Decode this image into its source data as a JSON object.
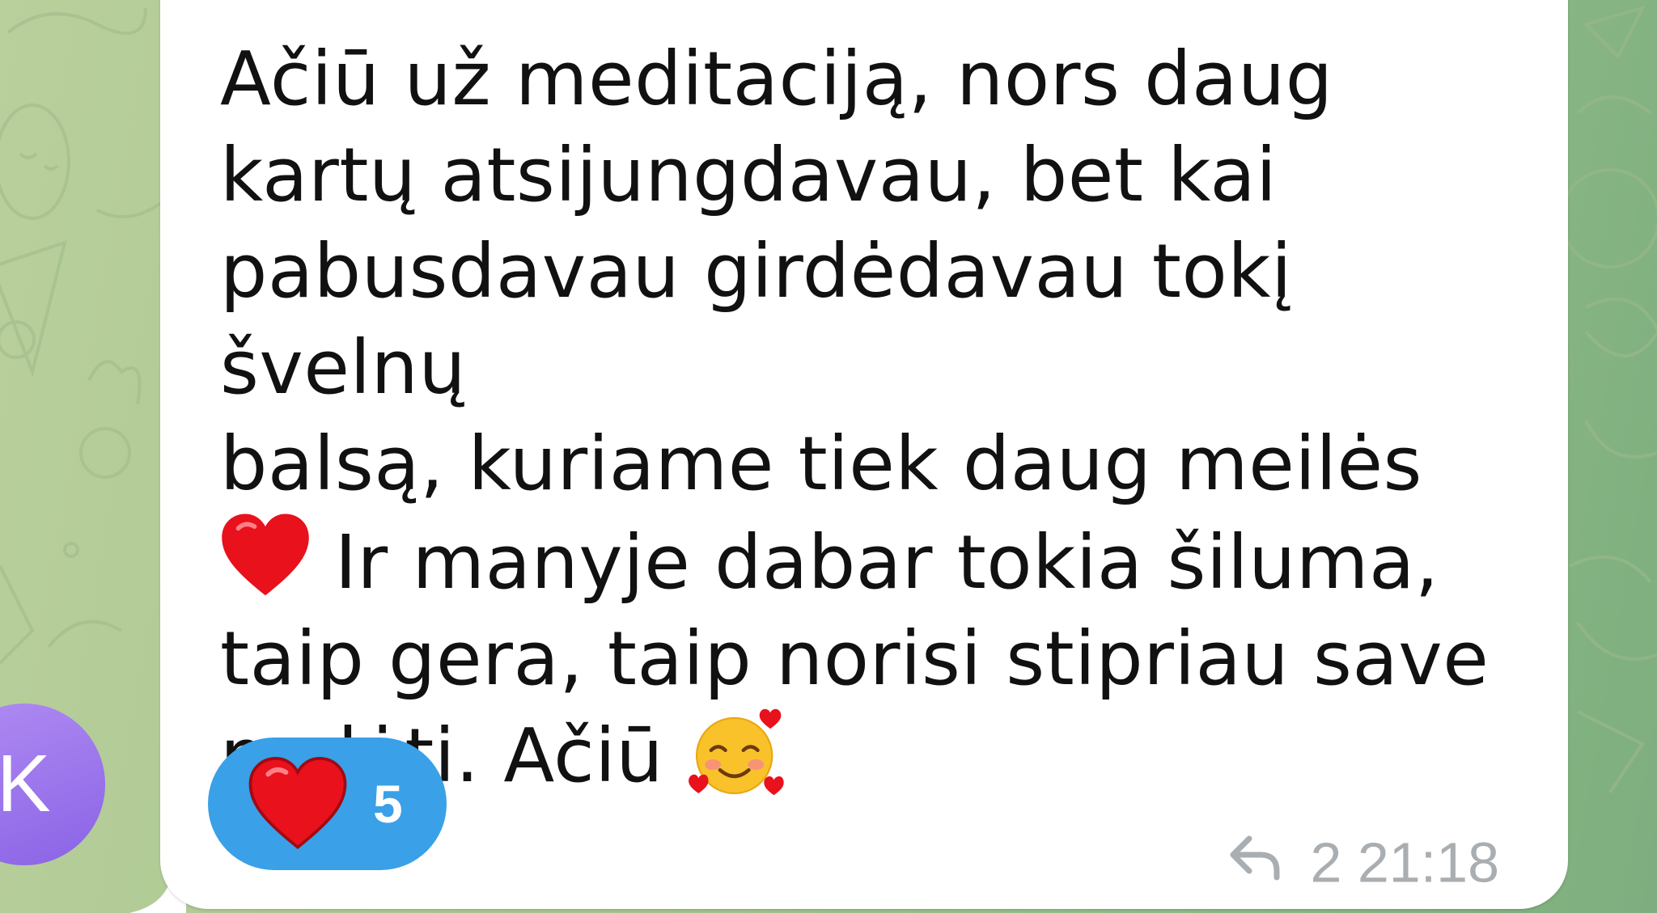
{
  "chat": {
    "message": {
      "lines": [
        "Ačiū už meditaciją, nors daug",
        "kartų atsijungdavau, bet kai",
        "pabusdavau girdėdavau tokį švelnų",
        "balsą, kuriame tiek daug meilės",
        " Ir manyje dabar tokia šiluma,",
        "taip gera, taip norisi stipriau save",
        "mylėti. Ačiū "
      ],
      "reaction": {
        "emoji": "heart",
        "count": "5"
      },
      "replies": "2",
      "time": "21:18"
    },
    "sender_avatar": {
      "initial": "K",
      "color": "#9a73ea"
    }
  },
  "colors": {
    "bubble": "#ffffff",
    "reaction_pill": "#3aa0e8",
    "meta_text": "#a9aeb2",
    "text": "#111111"
  },
  "icons": [
    "heart-emoji",
    "smiling-face-with-hearts-emoji",
    "reply-icon"
  ]
}
